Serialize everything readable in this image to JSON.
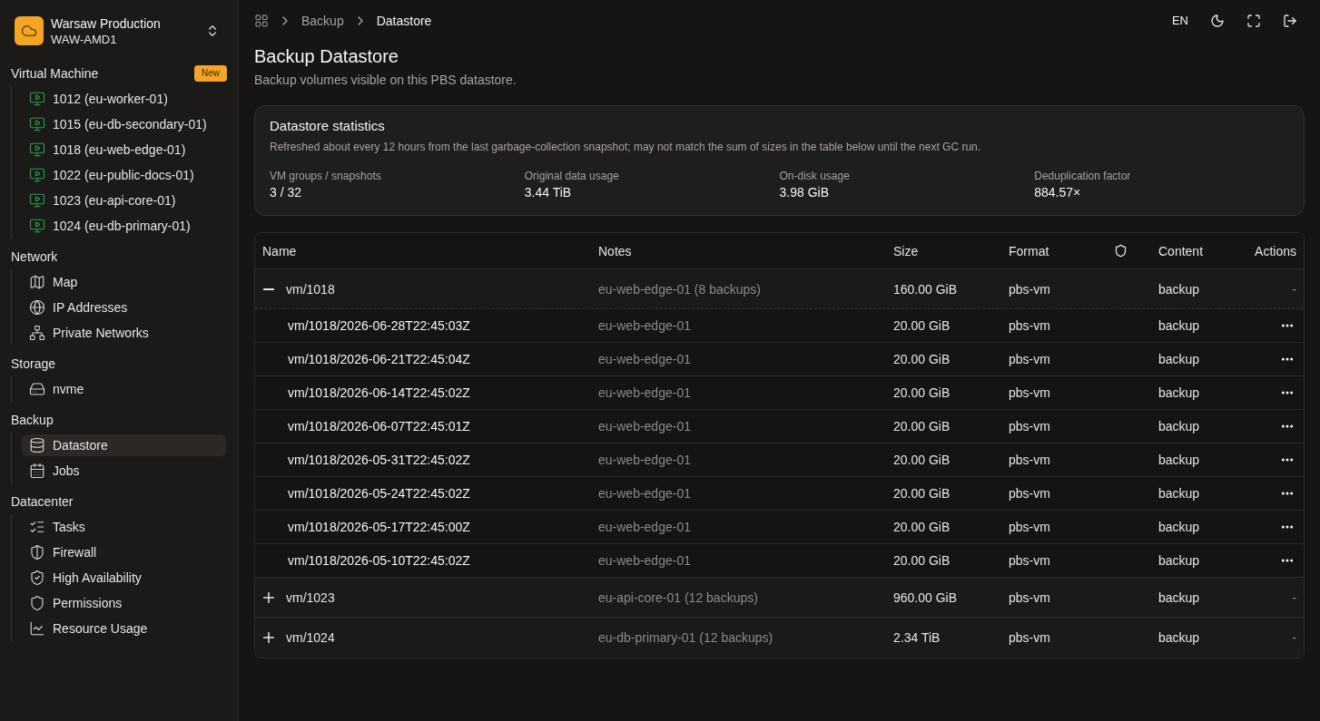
{
  "sidebar": {
    "workspace": {
      "name": "Warsaw Production",
      "code": "WAW-AMD1"
    },
    "sections": [
      {
        "title": "Virtual Machine",
        "badge": "New",
        "items": [
          {
            "label": "1012 (eu-worker-01)",
            "kind": "vm",
            "selected": false
          },
          {
            "label": "1015 (eu-db-secondary-01)",
            "kind": "vm",
            "selected": false
          },
          {
            "label": "1018 (eu-web-edge-01)",
            "kind": "vm",
            "selected": false
          },
          {
            "label": "1022 (eu-public-docs-01)",
            "kind": "vm",
            "selected": false
          },
          {
            "label": "1023 (eu-api-core-01)",
            "kind": "vm",
            "selected": false
          },
          {
            "label": "1024 (eu-db-primary-01)",
            "kind": "vm",
            "selected": false
          }
        ]
      },
      {
        "title": "Network",
        "items": [
          {
            "label": "Map",
            "kind": "map",
            "selected": false
          },
          {
            "label": "IP Addresses",
            "kind": "globe",
            "selected": false
          },
          {
            "label": "Private Networks",
            "kind": "network",
            "selected": false
          }
        ]
      },
      {
        "title": "Storage",
        "items": [
          {
            "label": "nvme",
            "kind": "drive",
            "selected": false
          }
        ]
      },
      {
        "title": "Backup",
        "items": [
          {
            "label": "Datastore",
            "kind": "database",
            "selected": true
          },
          {
            "label": "Jobs",
            "kind": "calendar",
            "selected": false
          }
        ]
      },
      {
        "title": "Datacenter",
        "items": [
          {
            "label": "Tasks",
            "kind": "tasks",
            "selected": false
          },
          {
            "label": "Firewall",
            "kind": "shield-half",
            "selected": false
          },
          {
            "label": "High Availability",
            "kind": "shield-check",
            "selected": false
          },
          {
            "label": "Permissions",
            "kind": "shield",
            "selected": false
          },
          {
            "label": "Resource Usage",
            "kind": "chart",
            "selected": false
          }
        ]
      }
    ]
  },
  "topbar": {
    "breadcrumb": [
      {
        "label": "Backup",
        "current": false
      },
      {
        "label": "Datastore",
        "current": true
      }
    ],
    "language": "EN"
  },
  "page": {
    "title": "Backup Datastore",
    "subtitle": "Backup volumes visible on this PBS datastore."
  },
  "stats": {
    "title": "Datastore statistics",
    "note": "Refreshed about every 12 hours from the last garbage-collection snapshot; may not match the sum of sizes in the table below until the next GC run.",
    "metrics": [
      {
        "label": "VM groups / snapshots",
        "value": "3 / 32"
      },
      {
        "label": "Original data usage",
        "value": "3.44 TiB"
      },
      {
        "label": "On-disk usage",
        "value": "3.98 GiB"
      },
      {
        "label": "Deduplication factor",
        "value": "884.57×"
      }
    ]
  },
  "table": {
    "columns": [
      {
        "kind": "text",
        "label": "Name"
      },
      {
        "kind": "text",
        "label": "Notes"
      },
      {
        "kind": "text",
        "label": "Size"
      },
      {
        "kind": "text",
        "label": "Format"
      },
      {
        "kind": "icon"
      },
      {
        "kind": "text",
        "label": "Content"
      },
      {
        "kind": "actions",
        "label": "Actions"
      }
    ],
    "groups": [
      {
        "name": "vm/1018",
        "notes": "eu-web-edge-01 (8 backups)",
        "size": "160.00 GiB",
        "format": "pbs-vm",
        "content": "backup",
        "actions": "-",
        "expanded": true,
        "children": [
          {
            "name": "vm/1018/2026-06-28T22:45:03Z",
            "notes": "eu-web-edge-01",
            "size": "20.00 GiB",
            "format": "pbs-vm",
            "content": "backup"
          },
          {
            "name": "vm/1018/2026-06-21T22:45:04Z",
            "notes": "eu-web-edge-01",
            "size": "20.00 GiB",
            "format": "pbs-vm",
            "content": "backup"
          },
          {
            "name": "vm/1018/2026-06-14T22:45:02Z",
            "notes": "eu-web-edge-01",
            "size": "20.00 GiB",
            "format": "pbs-vm",
            "content": "backup"
          },
          {
            "name": "vm/1018/2026-06-07T22:45:01Z",
            "notes": "eu-web-edge-01",
            "size": "20.00 GiB",
            "format": "pbs-vm",
            "content": "backup"
          },
          {
            "name": "vm/1018/2026-05-31T22:45:02Z",
            "notes": "eu-web-edge-01",
            "size": "20.00 GiB",
            "format": "pbs-vm",
            "content": "backup"
          },
          {
            "name": "vm/1018/2026-05-24T22:45:02Z",
            "notes": "eu-web-edge-01",
            "size": "20.00 GiB",
            "format": "pbs-vm",
            "content": "backup"
          },
          {
            "name": "vm/1018/2026-05-17T22:45:00Z",
            "notes": "eu-web-edge-01",
            "size": "20.00 GiB",
            "format": "pbs-vm",
            "content": "backup"
          },
          {
            "name": "vm/1018/2026-05-10T22:45:02Z",
            "notes": "eu-web-edge-01",
            "size": "20.00 GiB",
            "format": "pbs-vm",
            "content": "backup"
          }
        ]
      },
      {
        "name": "vm/1023",
        "notes": "eu-api-core-01 (12 backups)",
        "size": "960.00 GiB",
        "format": "pbs-vm",
        "content": "backup",
        "actions": "-",
        "expanded": false
      },
      {
        "name": "vm/1024",
        "notes": "eu-db-primary-01 (12 backups)",
        "size": "2.34 TiB",
        "format": "pbs-vm",
        "content": "backup",
        "actions": "-",
        "expanded": false
      }
    ]
  }
}
